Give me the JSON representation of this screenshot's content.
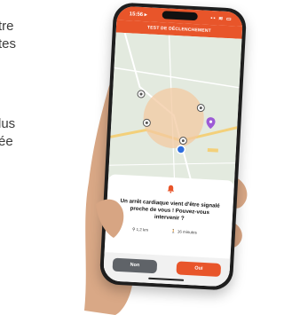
{
  "side_text": [
    "tre",
    "tes",
    "",
    "lus",
    "ée"
  ],
  "phone": {
    "status_time": "15:56 ▸",
    "status_icons": "▪▪ ≋ ▭",
    "app_title": "TEST DE DÉCLENCHEMENT",
    "alert_message": "Un arrêt cardiaque vient d'être signalé proche de vous ! Pouvez-vous intervenir ?",
    "distance": "1,2 km",
    "walk_time": "16 minutes",
    "no_label": "Non",
    "yes_label": "Oui"
  },
  "colors": {
    "accent": "#e8552a",
    "button_no": "#5f6368",
    "map_bg": "#e3eadf",
    "alert_circle": "#f3c9a1"
  }
}
